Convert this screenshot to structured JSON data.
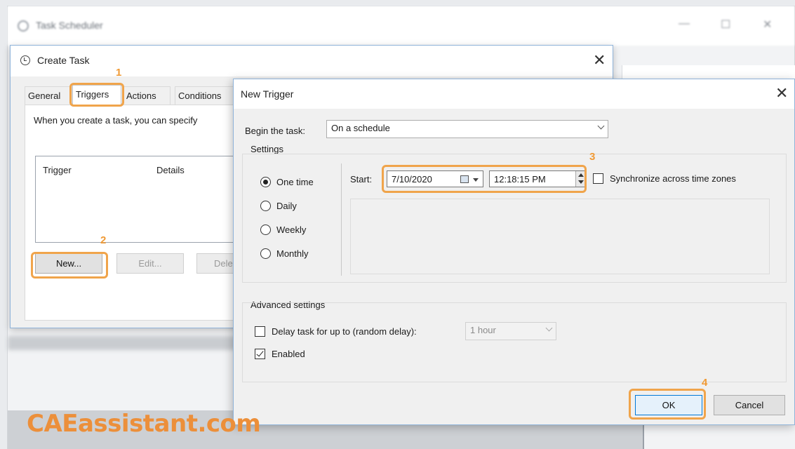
{
  "background_window": {
    "title": "Task Scheduler",
    "controls": [
      "—",
      "☐",
      "✕"
    ]
  },
  "create_task": {
    "title": "Create Task",
    "close": "✕",
    "tabs": [
      {
        "label": "General",
        "active": false
      },
      {
        "label": "Triggers",
        "active": true
      },
      {
        "label": "Actions",
        "active": false
      },
      {
        "label": "Conditions",
        "active": false
      }
    ],
    "description": "When you create a task, you can specify",
    "columns": [
      "Trigger",
      "Details"
    ],
    "buttons": {
      "new": "New...",
      "edit": "Edit...",
      "delete": "Dele"
    }
  },
  "new_trigger": {
    "title": "New Trigger",
    "close": "✕",
    "begin_label": "Begin the task:",
    "begin_value": "On a schedule",
    "settings_label": "Settings",
    "schedule_options": [
      {
        "label": "One time",
        "checked": true
      },
      {
        "label": "Daily",
        "checked": false
      },
      {
        "label": "Weekly",
        "checked": false
      },
      {
        "label": "Monthly",
        "checked": false
      }
    ],
    "start_label": "Start:",
    "start_date": "7/10/2020",
    "start_time": "12:18:15 PM",
    "sync_label": "Synchronize across time zones",
    "sync_checked": false,
    "advanced_label": "Advanced settings",
    "delay_label": "Delay task for up to (random delay):",
    "delay_checked": false,
    "delay_value": "1 hour",
    "enabled_label": "Enabled",
    "enabled_checked": true,
    "ok": "OK",
    "cancel": "Cancel"
  },
  "steps": [
    "1",
    "2",
    "3",
    "4"
  ],
  "watermark": "CAEassistant.com",
  "colors": {
    "highlight": "#f0a44b",
    "watermark": "#ec8f3a",
    "accent": "#0078d7"
  }
}
